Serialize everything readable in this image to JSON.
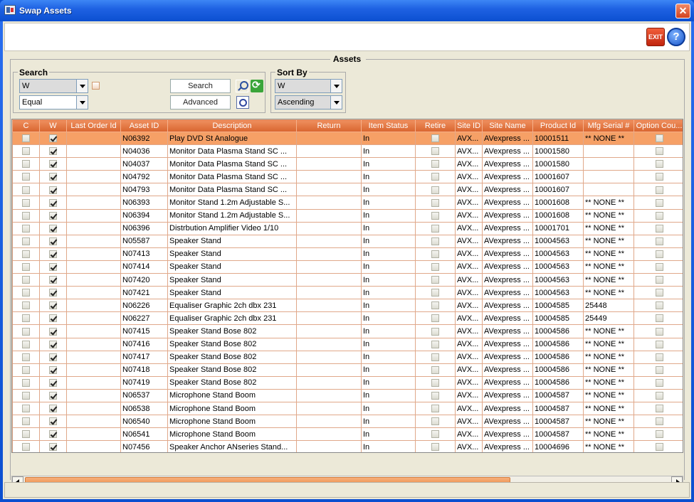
{
  "window": {
    "title": "Swap Assets"
  },
  "toolbar": {
    "exit_label": "EXIT",
    "help_label": "?"
  },
  "assets_label": "Assets",
  "search": {
    "group_title": "Search",
    "field_value": "W",
    "operator_value": "Equal",
    "search_button": "Search",
    "advanced_button": "Advanced"
  },
  "sort": {
    "group_title": "Sort By",
    "field_value": "W",
    "order_value": "Ascending"
  },
  "grid": {
    "columns": [
      "C",
      "W",
      "Last Order Id",
      "Asset ID",
      "Description",
      "Return",
      "Item Status",
      "Retire",
      "Site ID",
      "Site Name",
      "Product Id",
      "Mfg Serial #",
      "Option Cou..."
    ],
    "rows": [
      {
        "c": false,
        "w": true,
        "last_order": "",
        "asset_id": "N06392",
        "description": "Play DVD St Analogue",
        "return": "",
        "status": "In",
        "retire": false,
        "site_id": "AVX...",
        "site_name": "AVexpress ...",
        "product_id": "10001511",
        "serial": "** NONE **",
        "option": false,
        "selected": true
      },
      {
        "c": false,
        "w": true,
        "last_order": "",
        "asset_id": "N04036",
        "description": "Monitor Data Plasma Stand SC ...",
        "return": "",
        "status": "In",
        "retire": false,
        "site_id": "AVX...",
        "site_name": "AVexpress ...",
        "product_id": "10001580",
        "serial": "",
        "option": false
      },
      {
        "c": false,
        "w": true,
        "last_order": "",
        "asset_id": "N04037",
        "description": "Monitor Data Plasma Stand SC ...",
        "return": "",
        "status": "In",
        "retire": false,
        "site_id": "AVX...",
        "site_name": "AVexpress ...",
        "product_id": "10001580",
        "serial": "",
        "option": false
      },
      {
        "c": false,
        "w": true,
        "last_order": "",
        "asset_id": "N04792",
        "description": "Monitor Data Plasma Stand SC ...",
        "return": "",
        "status": "In",
        "retire": false,
        "site_id": "AVX...",
        "site_name": "AVexpress ...",
        "product_id": "10001607",
        "serial": "",
        "option": false
      },
      {
        "c": false,
        "w": true,
        "last_order": "",
        "asset_id": "N04793",
        "description": "Monitor Data Plasma Stand SC ...",
        "return": "",
        "status": "In",
        "retire": false,
        "site_id": "AVX...",
        "site_name": "AVexpress ...",
        "product_id": "10001607",
        "serial": "",
        "option": false
      },
      {
        "c": false,
        "w": true,
        "last_order": "",
        "asset_id": "N06393",
        "description": "Monitor Stand 1.2m Adjustable S...",
        "return": "",
        "status": "In",
        "retire": false,
        "site_id": "AVX...",
        "site_name": "AVexpress ...",
        "product_id": "10001608",
        "serial": "** NONE **",
        "option": false
      },
      {
        "c": false,
        "w": true,
        "last_order": "",
        "asset_id": "N06394",
        "description": "Monitor Stand 1.2m Adjustable S...",
        "return": "",
        "status": "In",
        "retire": false,
        "site_id": "AVX...",
        "site_name": "AVexpress ...",
        "product_id": "10001608",
        "serial": "** NONE **",
        "option": false
      },
      {
        "c": false,
        "w": true,
        "last_order": "",
        "asset_id": "N06396",
        "description": "Distrbution Amplifier Video 1/10",
        "return": "",
        "status": "In",
        "retire": false,
        "site_id": "AVX...",
        "site_name": "AVexpress ...",
        "product_id": "10001701",
        "serial": "** NONE **",
        "option": false
      },
      {
        "c": false,
        "w": true,
        "last_order": "",
        "asset_id": "N05587",
        "description": "Speaker Stand",
        "return": "",
        "status": "In",
        "retire": false,
        "site_id": "AVX...",
        "site_name": "AVexpress ...",
        "product_id": "10004563",
        "serial": "** NONE **",
        "option": false
      },
      {
        "c": false,
        "w": true,
        "last_order": "",
        "asset_id": "N07413",
        "description": "Speaker Stand",
        "return": "",
        "status": "In",
        "retire": false,
        "site_id": "AVX...",
        "site_name": "AVexpress ...",
        "product_id": "10004563",
        "serial": "** NONE **",
        "option": false
      },
      {
        "c": false,
        "w": true,
        "last_order": "",
        "asset_id": "N07414",
        "description": "Speaker Stand",
        "return": "",
        "status": "In",
        "retire": false,
        "site_id": "AVX...",
        "site_name": "AVexpress ...",
        "product_id": "10004563",
        "serial": "** NONE **",
        "option": false
      },
      {
        "c": false,
        "w": true,
        "last_order": "",
        "asset_id": "N07420",
        "description": "Speaker Stand",
        "return": "",
        "status": "In",
        "retire": false,
        "site_id": "AVX...",
        "site_name": "AVexpress ...",
        "product_id": "10004563",
        "serial": "** NONE **",
        "option": false
      },
      {
        "c": false,
        "w": true,
        "last_order": "",
        "asset_id": "N07421",
        "description": "Speaker Stand",
        "return": "",
        "status": "In",
        "retire": false,
        "site_id": "AVX...",
        "site_name": "AVexpress ...",
        "product_id": "10004563",
        "serial": "** NONE **",
        "option": false
      },
      {
        "c": false,
        "w": true,
        "last_order": "",
        "asset_id": "N06226",
        "description": "Equaliser Graphic 2ch dbx 231",
        "return": "",
        "status": "In",
        "retire": false,
        "site_id": "AVX...",
        "site_name": "AVexpress ...",
        "product_id": "10004585",
        "serial": "25448",
        "option": false
      },
      {
        "c": false,
        "w": true,
        "last_order": "",
        "asset_id": "N06227",
        "description": "Equaliser Graphic 2ch dbx 231",
        "return": "",
        "status": "In",
        "retire": false,
        "site_id": "AVX...",
        "site_name": "AVexpress ...",
        "product_id": "10004585",
        "serial": "25449",
        "option": false
      },
      {
        "c": false,
        "w": true,
        "last_order": "",
        "asset_id": "N07415",
        "description": "Speaker Stand Bose 802",
        "return": "",
        "status": "In",
        "retire": false,
        "site_id": "AVX...",
        "site_name": "AVexpress ...",
        "product_id": "10004586",
        "serial": "** NONE **",
        "option": false
      },
      {
        "c": false,
        "w": true,
        "last_order": "",
        "asset_id": "N07416",
        "description": "Speaker Stand Bose 802",
        "return": "",
        "status": "In",
        "retire": false,
        "site_id": "AVX...",
        "site_name": "AVexpress ...",
        "product_id": "10004586",
        "serial": "** NONE **",
        "option": false
      },
      {
        "c": false,
        "w": true,
        "last_order": "",
        "asset_id": "N07417",
        "description": "Speaker Stand Bose 802",
        "return": "",
        "status": "In",
        "retire": false,
        "site_id": "AVX...",
        "site_name": "AVexpress ...",
        "product_id": "10004586",
        "serial": "** NONE **",
        "option": false
      },
      {
        "c": false,
        "w": true,
        "last_order": "",
        "asset_id": "N07418",
        "description": "Speaker Stand Bose 802",
        "return": "",
        "status": "In",
        "retire": false,
        "site_id": "AVX...",
        "site_name": "AVexpress ...",
        "product_id": "10004586",
        "serial": "** NONE **",
        "option": false
      },
      {
        "c": false,
        "w": true,
        "last_order": "",
        "asset_id": "N07419",
        "description": "Speaker Stand Bose 802",
        "return": "",
        "status": "In",
        "retire": false,
        "site_id": "AVX...",
        "site_name": "AVexpress ...",
        "product_id": "10004586",
        "serial": "** NONE **",
        "option": false
      },
      {
        "c": false,
        "w": true,
        "last_order": "",
        "asset_id": "N06537",
        "description": "Microphone Stand Boom",
        "return": "",
        "status": "In",
        "retire": false,
        "site_id": "AVX...",
        "site_name": "AVexpress ...",
        "product_id": "10004587",
        "serial": "** NONE **",
        "option": false
      },
      {
        "c": false,
        "w": true,
        "last_order": "",
        "asset_id": "N06538",
        "description": "Microphone Stand Boom",
        "return": "",
        "status": "In",
        "retire": false,
        "site_id": "AVX...",
        "site_name": "AVexpress ...",
        "product_id": "10004587",
        "serial": "** NONE **",
        "option": false
      },
      {
        "c": false,
        "w": true,
        "last_order": "",
        "asset_id": "N06540",
        "description": "Microphone Stand Boom",
        "return": "",
        "status": "In",
        "retire": false,
        "site_id": "AVX...",
        "site_name": "AVexpress ...",
        "product_id": "10004587",
        "serial": "** NONE **",
        "option": false
      },
      {
        "c": false,
        "w": true,
        "last_order": "",
        "asset_id": "N06541",
        "description": "Microphone Stand Boom",
        "return": "",
        "status": "In",
        "retire": false,
        "site_id": "AVX...",
        "site_name": "AVexpress ...",
        "product_id": "10004587",
        "serial": "** NONE **",
        "option": false
      },
      {
        "c": false,
        "w": true,
        "last_order": "",
        "asset_id": "N07456",
        "description": "Speaker Anchor ANseries Stand...",
        "return": "",
        "status": "In",
        "retire": false,
        "site_id": "AVX...",
        "site_name": "AVexpress ...",
        "product_id": "10004696",
        "serial": "** NONE **",
        "option": false
      }
    ]
  },
  "colors": {
    "header_orange": "#d9652f",
    "selected_row": "#f6a066",
    "title_blue": "#0b4fd0"
  }
}
